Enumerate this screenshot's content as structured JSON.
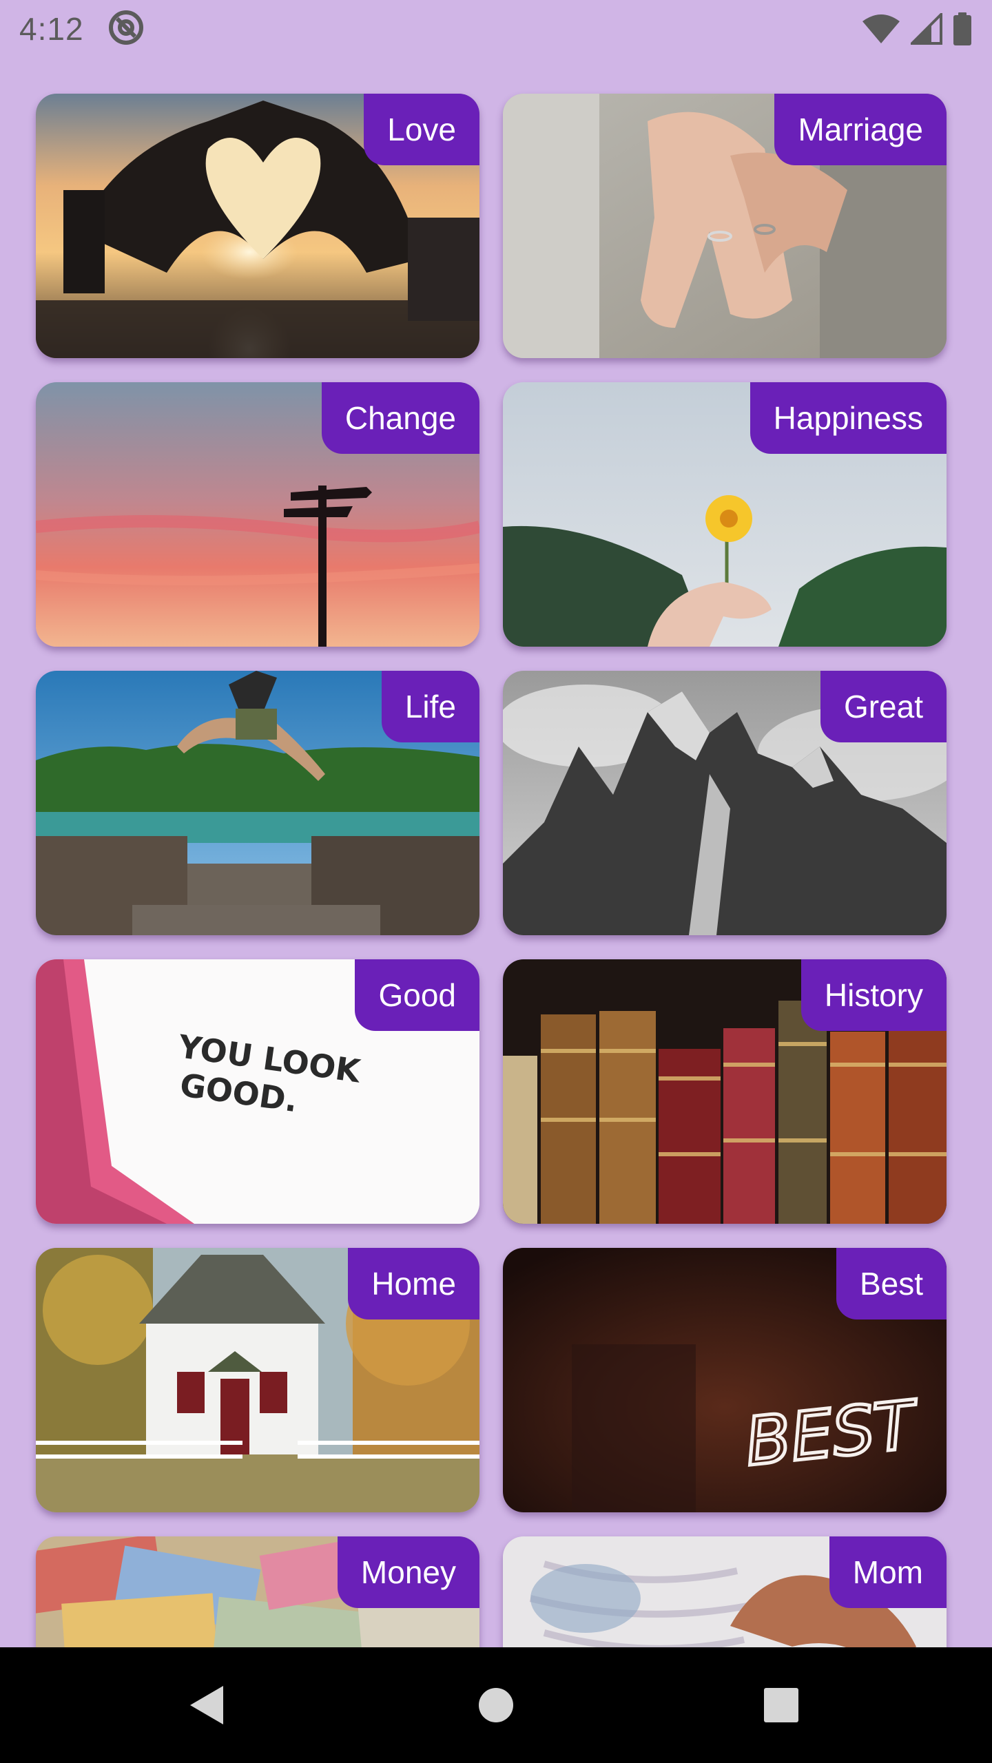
{
  "status_bar": {
    "time": "4:12",
    "icons": [
      "at-sign-icon",
      "wifi-icon",
      "cellular-signal-icon",
      "battery-icon"
    ]
  },
  "categories": [
    {
      "label": "Love",
      "image": "heart-hands-sunset-photo"
    },
    {
      "label": "Marriage",
      "image": "wedding-ring-hands-photo"
    },
    {
      "label": "Change",
      "image": "signpost-sunset-photo"
    },
    {
      "label": "Happiness",
      "image": "yellow-flower-hand-photo"
    },
    {
      "label": "Life",
      "image": "person-jumping-lake-photo"
    },
    {
      "label": "Great",
      "image": "mountain-peaks-photo"
    },
    {
      "label": "Good",
      "image": "you-look-good-paper-photo"
    },
    {
      "label": "History",
      "image": "old-books-photo"
    },
    {
      "label": "Home",
      "image": "white-house-photo"
    },
    {
      "label": "Best",
      "image": "best-neon-sign-photo"
    },
    {
      "label": "Money",
      "image": "banknotes-photo"
    },
    {
      "label": "Mom",
      "image": "mother-baby-photo"
    }
  ],
  "nav": {
    "buttons": [
      "back-icon",
      "home-icon",
      "recents-icon"
    ]
  },
  "colors": {
    "background": "#d0b5e6",
    "label_badge": "#6a20b8",
    "nav_bar": "#000000"
  }
}
